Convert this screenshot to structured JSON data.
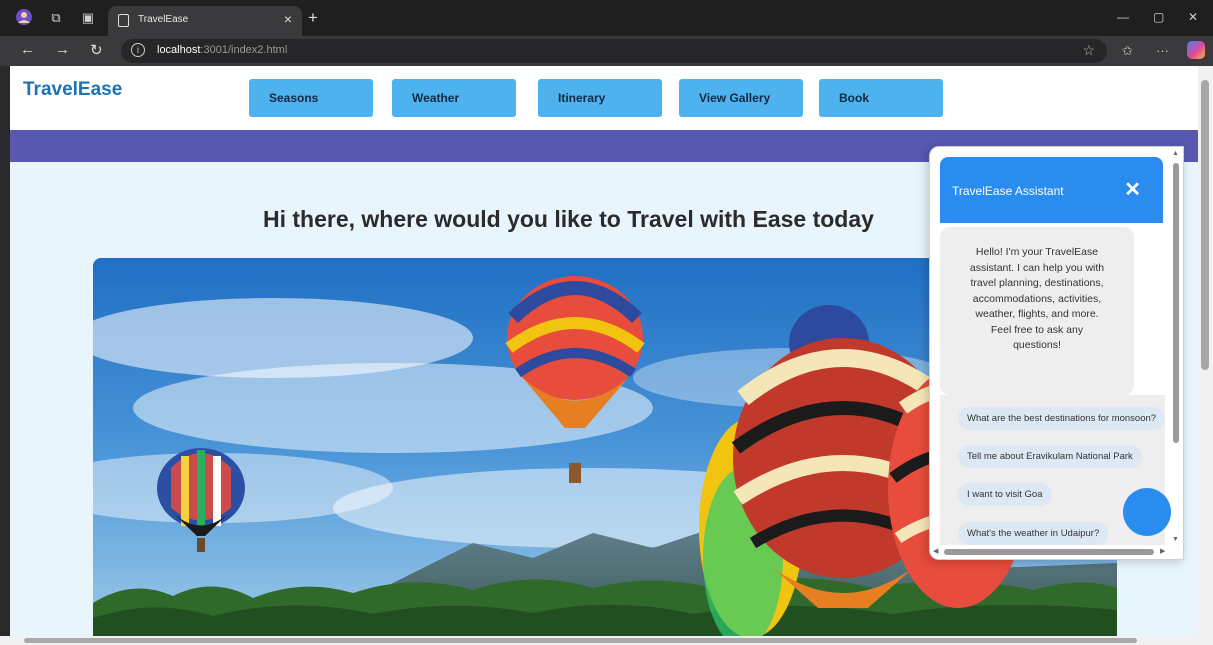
{
  "browser": {
    "tab_title": "TravelEase",
    "url_host": "localhost",
    "url_rest": ":3001/index2.html"
  },
  "site": {
    "logo": "TravelEase",
    "nav": [
      "Seasons",
      "Weather",
      "Itinerary",
      "View Gallery",
      "Book"
    ],
    "hero_title": "Hi there, where would you like to Travel with Ease today"
  },
  "chat": {
    "title": "TravelEase Assistant",
    "close": "✕",
    "greeting": "Hello! I'm your TravelEase assistant. I can help you with travel planning, destinations, accommodations, activities, weather, flights, and more. Feel free to ask any questions!",
    "suggestions": [
      "What are the best destinations for monsoon?",
      "Tell me about Eravikulam National Park",
      "I want to visit Goa",
      "What's the weather in Udaipur?"
    ]
  },
  "colors": {
    "accent": "#2b8cf0",
    "nav_button": "#4db2ee",
    "banner": "#5858b0",
    "logo": "#1a73b8"
  },
  "icons": [
    "profile-icon",
    "workspaces-icon",
    "tab-actions-icon",
    "page-icon",
    "close-icon",
    "plus-icon",
    "back-icon",
    "forward-icon",
    "refresh-icon",
    "info-icon",
    "star-icon",
    "favorites-icon",
    "more-icon",
    "copilot-icon"
  ]
}
